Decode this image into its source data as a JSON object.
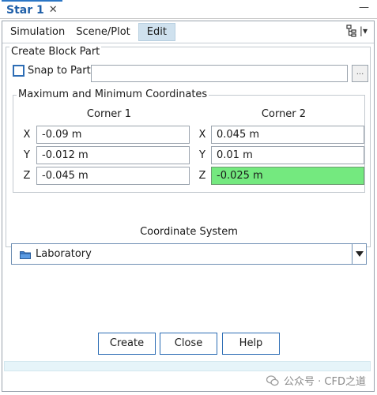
{
  "tab": {
    "title": "Star 1",
    "close_glyph": "✕",
    "minimize_glyph": "—"
  },
  "menu": {
    "items": [
      {
        "label": "Simulation"
      },
      {
        "label": "Scene/Plot"
      },
      {
        "label": "Edit"
      }
    ],
    "active": "Edit",
    "tree_icon": "tree-view-icon",
    "dropdown_glyph": "▾"
  },
  "create_block": {
    "group_title": "Create Block Part",
    "snap_label": "Snap to Part",
    "snap_checked": false,
    "snap_value": "",
    "browse_label": "..."
  },
  "coords": {
    "group_title": "Maximum and Minimum Coordinates",
    "corner1": {
      "heading": "Corner 1",
      "x": "-0.09 m",
      "y": "-0.012 m",
      "z": "-0.045 m"
    },
    "corner2": {
      "heading": "Corner 2",
      "x": "0.045 m",
      "y": "0.01 m",
      "z": "-0.025 m"
    },
    "axes": {
      "x": "X",
      "y": "Y",
      "z": "Z"
    },
    "highlight_color": "#74e97f"
  },
  "coordinate_system": {
    "label": "Coordinate System",
    "selected": "Laboratory",
    "icon": "folder-icon"
  },
  "buttons": {
    "create": "Create",
    "close": "Close",
    "help": "Help"
  },
  "watermark": {
    "text": "公众号 · CFD之道"
  },
  "colors": {
    "accent": "#2d6db5",
    "tab_title": "#1f5fa8",
    "status_bar": "#e6f4f9"
  }
}
